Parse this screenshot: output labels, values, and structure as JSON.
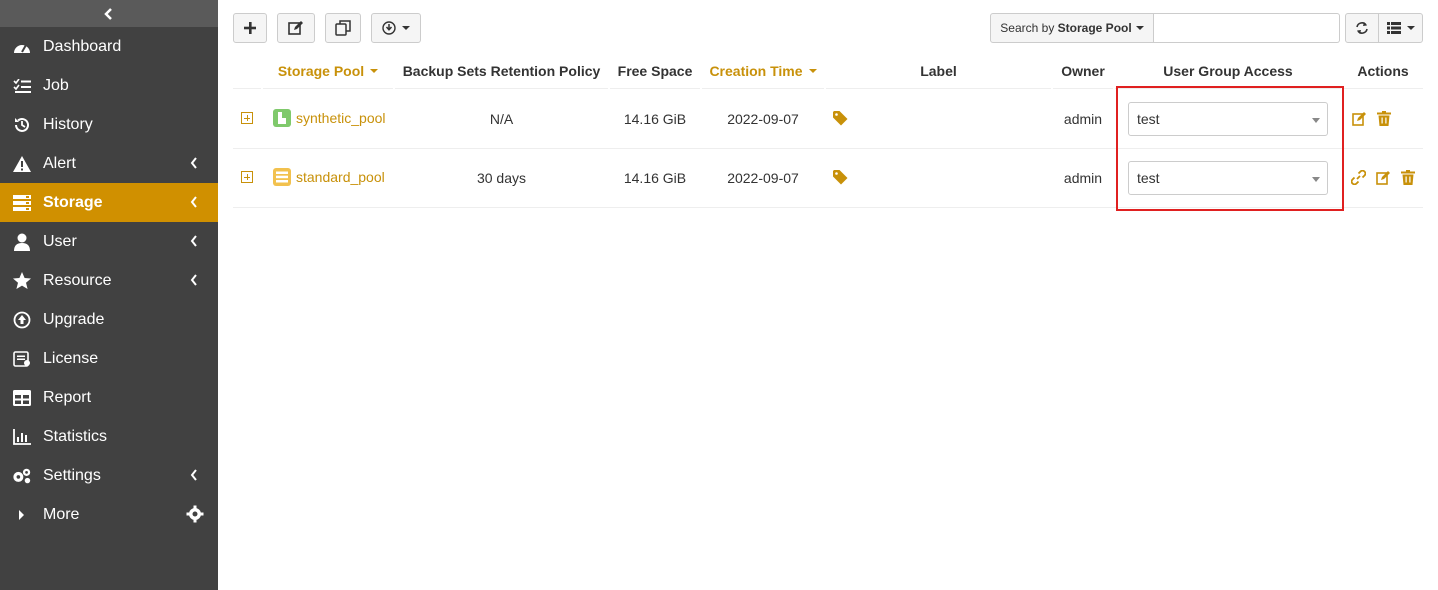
{
  "sidebar": {
    "items": [
      {
        "label": "Dashboard",
        "icon": "dashboard-icon"
      },
      {
        "label": "Job",
        "icon": "job-list-icon"
      },
      {
        "label": "History",
        "icon": "history-icon"
      },
      {
        "label": "Alert",
        "icon": "alert-icon"
      },
      {
        "label": "Storage",
        "icon": "storage-icon"
      },
      {
        "label": "User",
        "icon": "user-icon"
      },
      {
        "label": "Resource",
        "icon": "star-icon"
      },
      {
        "label": "Upgrade",
        "icon": "upgrade-icon"
      },
      {
        "label": "License",
        "icon": "license-icon"
      },
      {
        "label": "Report",
        "icon": "report-icon"
      },
      {
        "label": "Statistics",
        "icon": "statistics-icon"
      },
      {
        "label": "Settings",
        "icon": "settings-icon"
      },
      {
        "label": "More",
        "icon": "caret-right-icon"
      }
    ],
    "active": "Storage"
  },
  "toolbar": {
    "search_prefix": "Search by ",
    "search_field": "Storage Pool",
    "search_value": ""
  },
  "table": {
    "columns": [
      "Storage Pool",
      "Backup Sets Retention Policy",
      "Free Space",
      "Creation Time",
      "Label",
      "Owner",
      "User Group Access",
      "Actions"
    ],
    "rows": [
      {
        "pool": "synthetic_pool",
        "retention": "N/A",
        "free_space": "14.16 GiB",
        "created": "2022-09-07",
        "owner": "admin",
        "access": "test"
      },
      {
        "pool": "standard_pool",
        "retention": "30 days",
        "free_space": "14.16 GiB",
        "created": "2022-09-07",
        "owner": "admin",
        "access": "test"
      }
    ]
  },
  "colors": {
    "accent": "#c8910a",
    "sidebar_bg": "#414141",
    "active_bg": "#d09000",
    "highlight": "#e02020"
  }
}
